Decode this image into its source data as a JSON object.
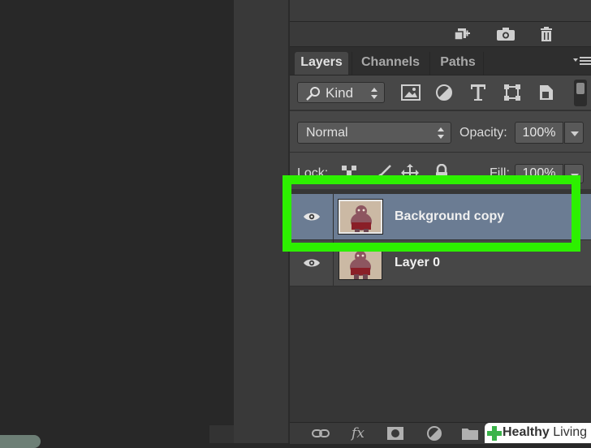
{
  "toolbar_top": {
    "icons": [
      "new-layer-group-icon",
      "snapshot-camera-icon",
      "trash-icon"
    ]
  },
  "tabs": [
    {
      "label": "Layers",
      "active": true
    },
    {
      "label": "Channels",
      "active": false
    },
    {
      "label": "Paths",
      "active": false
    }
  ],
  "filter": {
    "kind_label": "Kind",
    "icons": [
      "pixel-layer-filter-icon",
      "adjustment-layer-filter-icon",
      "type-layer-filter-icon",
      "shape-layer-filter-icon",
      "smart-object-filter-icon"
    ]
  },
  "blend": {
    "mode": "Normal",
    "opacity_label": "Opacity:",
    "opacity_value": "100%"
  },
  "lock": {
    "label": "Lock:",
    "fill_label": "Fill:",
    "fill_value": "100%"
  },
  "layers": [
    {
      "name": "Background copy",
      "selected": true,
      "visible": true
    },
    {
      "name": "Layer 0",
      "selected": false,
      "visible": true
    }
  ],
  "bottom_bar": {
    "fx_label": "fx"
  },
  "watermark": {
    "brand_bold": "Healthy",
    "brand_light": "Living"
  },
  "colors": {
    "highlight": "#2df000",
    "selected_layer": "#6b7c93",
    "panel_bg": "#474747"
  }
}
